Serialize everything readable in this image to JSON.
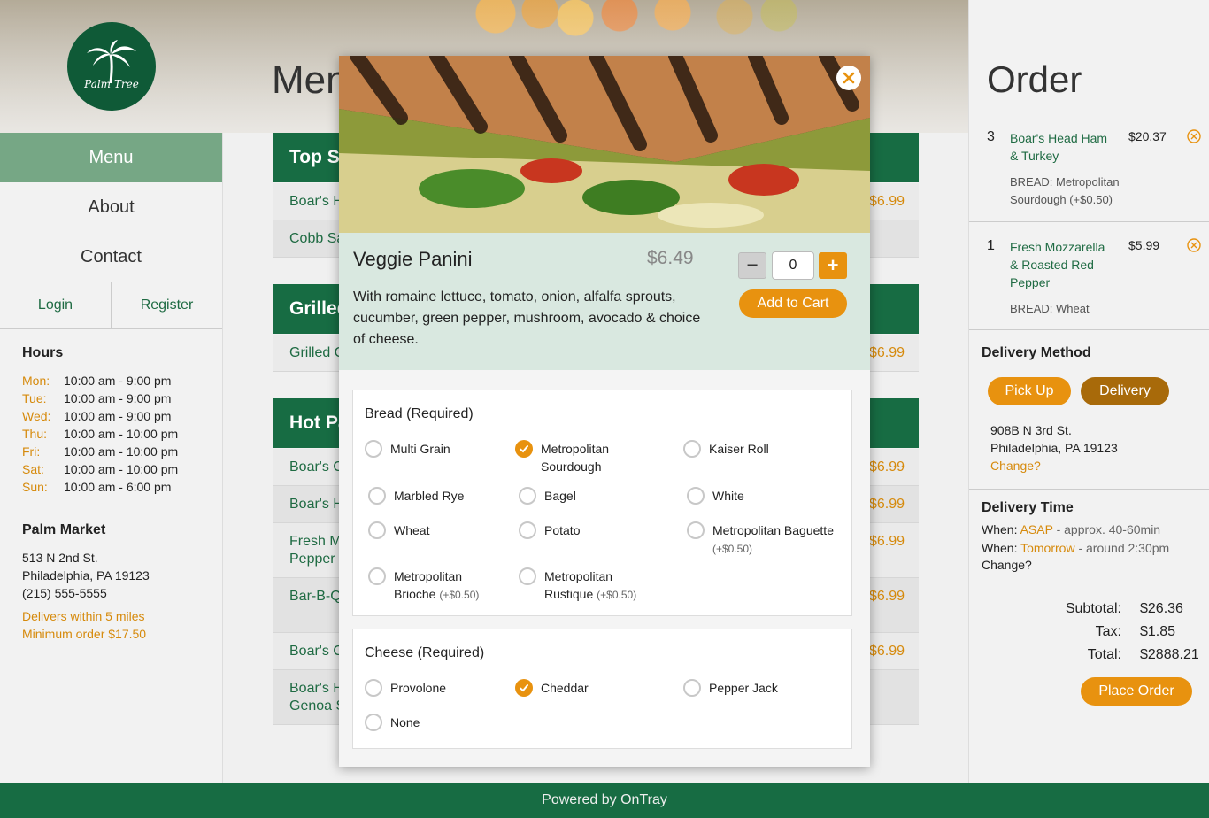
{
  "brand": {
    "logo_text": "Palm Tree"
  },
  "menu_heading": "Menu",
  "nav": {
    "items": [
      {
        "label": "Menu"
      },
      {
        "label": "About"
      },
      {
        "label": "Contact"
      }
    ],
    "login": "Login",
    "register": "Register"
  },
  "hours": {
    "title": "Hours",
    "rows": [
      {
        "day": "Mon:",
        "time": "10:00 am - 9:00 pm"
      },
      {
        "day": "Tue:",
        "time": "10:00 am - 9:00 pm"
      },
      {
        "day": "Wed:",
        "time": "10:00 am - 9:00 pm"
      },
      {
        "day": "Thu:",
        "time": "10:00 am - 10:00 pm"
      },
      {
        "day": "Fri:",
        "time": "10:00 am - 10:00 pm"
      },
      {
        "day": "Sat:",
        "time": "10:00 am - 10:00 pm"
      },
      {
        "day": "Sun:",
        "time": "10:00 am - 6:00 pm"
      }
    ]
  },
  "market": {
    "title": "Palm Market",
    "street": "513 N 2nd St.",
    "city": "Philadelphia, PA 19123",
    "phone": "(215) 555-5555",
    "delivery_note": "Delivers within 5 miles",
    "minimum_note": "Minimum order $17.50"
  },
  "menu": {
    "categories": [
      {
        "name": "Top Se"
      },
      {
        "name": "Grilled"
      },
      {
        "name": "Hot Pa"
      }
    ],
    "items": [
      {
        "name": "Boar's H",
        "price": "$6.99"
      },
      {
        "name": "Cobb Sa",
        "price": ""
      },
      {
        "name": "Grilled C",
        "price": "$6.99"
      },
      {
        "name": "Boar's C",
        "price": "$6.99"
      },
      {
        "name": "Boar's H",
        "price": "$6.99"
      },
      {
        "name": "Fresh M",
        "name2": "Pepper",
        "price": "$6.99"
      },
      {
        "name": "Bar-B-Q",
        "price": "$6.99"
      },
      {
        "name": "Boar's C",
        "price": "$6.99"
      },
      {
        "name": "Boar's H",
        "name2": "Genoa S",
        "price": ""
      }
    ]
  },
  "order": {
    "title": "Order",
    "lines": [
      {
        "qty": "3",
        "name": "Boar's Head Ham & Turkey",
        "price": "$20.37",
        "option": "BREAD: Metropolitan Sourdough (+$0.50)"
      },
      {
        "qty": "1",
        "name": "Fresh Mozzarella & Roasted Red Pepper",
        "price": "$5.99",
        "option": "BREAD: Wheat"
      }
    ],
    "delivery_method": {
      "title": "Delivery Method",
      "pickup": "Pick Up",
      "delivery": "Delivery",
      "address_line1": "908B N 3rd St.",
      "address_line2": "Philadelphia, PA 19123",
      "change": "Change?"
    },
    "delivery_time": {
      "title": "Delivery Time",
      "when_label": "When:",
      "asap": "ASAP",
      "asap_desc": "- approx. 40-60min",
      "tomorrow": "Tomorrow",
      "tomorrow_desc": "- around 2:30pm",
      "change": "Change?"
    },
    "subtotal_label": "Subtotal:",
    "subtotal": "$26.36",
    "tax_label": "Tax:",
    "tax": "$1.85",
    "total_label": "Total:",
    "total": "$2888.21",
    "place_order": "Place Order"
  },
  "modal": {
    "name": "Veggie Panini",
    "price": "$6.49",
    "description": "With romaine lettuce, tomato, onion, alfalfa sprouts, cucumber, green pepper, mushroom, avocado & choice of cheese.",
    "quantity": "0",
    "minus": "−",
    "plus": "+",
    "add_to_cart": "Add to Cart",
    "bread": {
      "title": "Bread (Required)",
      "options": [
        {
          "label": "Multi Grain",
          "surcharge": "",
          "checked": false
        },
        {
          "label": "Metropolitan Sourdough",
          "surcharge": "",
          "checked": true
        },
        {
          "label": "Kaiser Roll",
          "surcharge": "",
          "checked": false
        },
        {
          "label": "Marbled Rye",
          "surcharge": "",
          "checked": false
        },
        {
          "label": "Bagel",
          "surcharge": "",
          "checked": false
        },
        {
          "label": "White",
          "surcharge": "",
          "checked": false
        },
        {
          "label": "Wheat",
          "surcharge": "",
          "checked": false
        },
        {
          "label": "Potato",
          "surcharge": "",
          "checked": false
        },
        {
          "label": "Metropolitan Baguette",
          "surcharge": "(+$0.50)",
          "checked": false
        },
        {
          "label": "Metropolitan Brioche",
          "surcharge": "(+$0.50)",
          "checked": false
        },
        {
          "label": "Metropolitan Rustique",
          "surcharge": "(+$0.50)",
          "checked": false
        }
      ]
    },
    "cheese": {
      "title": "Cheese (Required)",
      "options": [
        {
          "label": "Provolone",
          "checked": false
        },
        {
          "label": "Cheddar",
          "checked": true
        },
        {
          "label": "Pepper Jack",
          "checked": false
        },
        {
          "label": "None",
          "checked": false
        }
      ]
    }
  },
  "footer": {
    "text": "Powered by OnTray"
  },
  "colors": {
    "brand_green": "#176c43",
    "accent_orange": "#e8920f",
    "nav_active": "#76a785"
  }
}
